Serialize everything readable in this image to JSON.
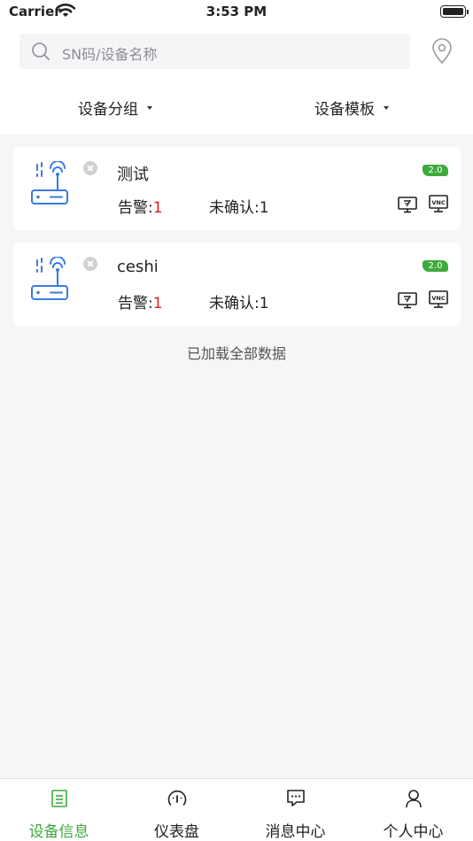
{
  "status_bar": {
    "carrier": "Carrier",
    "time": "3:53 PM"
  },
  "search": {
    "placeholder": "SN码/设备名称"
  },
  "filters": {
    "group_label": "设备分组",
    "template_label": "设备模板"
  },
  "devices": [
    {
      "name": "测试",
      "version": "2.0",
      "alarm_label": "告警:",
      "alarm_count": "1",
      "unconfirmed_label": "未确认:1"
    },
    {
      "name": "ceshi",
      "version": "2.0",
      "alarm_label": "告警:",
      "alarm_count": "1",
      "unconfirmed_label": "未确认:1"
    }
  ],
  "vnc_label": "VNC",
  "loaded_text": "已加载全部数据",
  "tab_bar": {
    "active_color": "#3eaa3c",
    "tabs": [
      {
        "label": "设备信息",
        "icon": "device-list-icon",
        "active": true
      },
      {
        "label": "仪表盘",
        "icon": "dashboard-gauge-icon",
        "active": false
      },
      {
        "label": "消息中心",
        "icon": "message-bubble-icon",
        "active": false
      },
      {
        "label": "个人中心",
        "icon": "person-icon",
        "active": false
      }
    ]
  }
}
